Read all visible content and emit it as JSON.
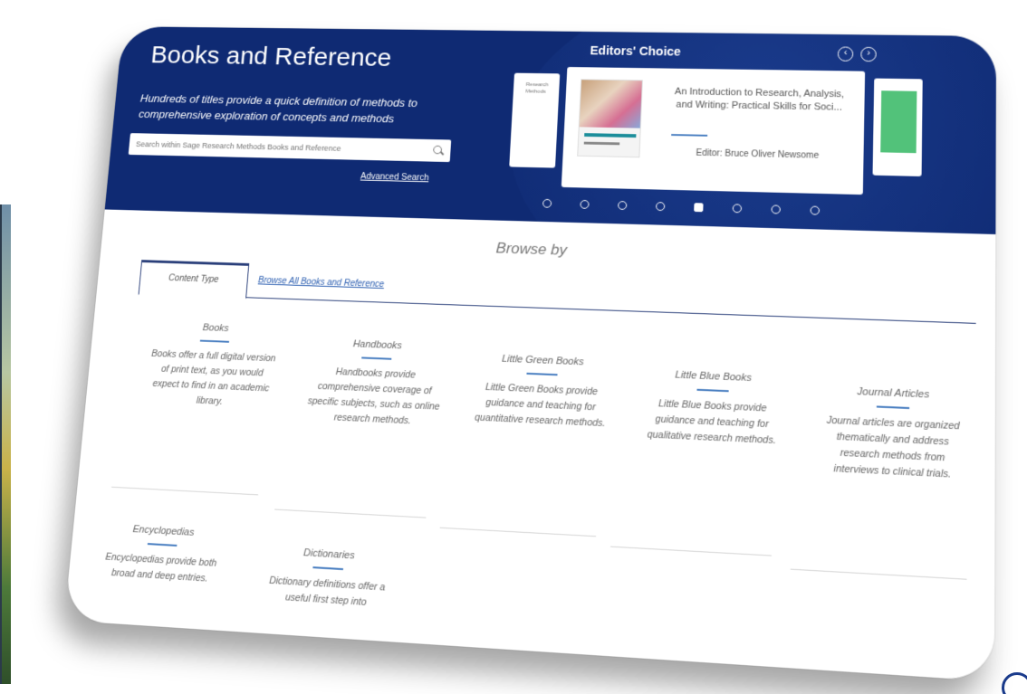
{
  "hero": {
    "title": "Books and Reference",
    "subtitle": "Hundreds of titles provide a quick definition of methods to comprehensive exploration of concepts and methods",
    "search_placeholder": "Search within Sage Research Methods Books and Reference",
    "advanced_search": "Advanced Search"
  },
  "editors_choice": {
    "title": "Editors' Choice",
    "prev_icon": "‹",
    "next_icon": "›",
    "left_card_text": "Research Methods",
    "book_title": "An Introduction to Research, Analysis, and Writing: Practical Skills for Soci...",
    "book_editor": "Editor: Bruce Oliver Newsome",
    "dots": 8,
    "active_dot": 5
  },
  "browse": {
    "heading": "Browse by",
    "tab_content_type": "Content Type",
    "tab_browse_all": "Browse All Books and Reference",
    "items": [
      {
        "title": "Books",
        "desc": "Books offer a full digital version of print text, as you would expect to find in an academic library."
      },
      {
        "title": "Handbooks",
        "desc": "Handbooks provide comprehensive coverage of specific subjects, such as online research methods."
      },
      {
        "title": "Little Green Books",
        "desc": "Little Green Books provide guidance and teaching for quantitative research methods."
      },
      {
        "title": "Little Blue Books",
        "desc": "Little Blue Books provide guidance and teaching for qualitative research methods."
      },
      {
        "title": "Journal Articles",
        "desc": "Journal articles are organized thematically and address research methods from interviews to clinical trials."
      },
      {
        "title": "Encyclopedias",
        "desc": "Encyclopedias provide both broad and deep entries."
      },
      {
        "title": "Dictionaries",
        "desc": "Dictionary definitions offer a useful first step into"
      }
    ]
  },
  "colors": {
    "hero_bg": "#0f2a73",
    "accent": "#4a7fc1"
  }
}
